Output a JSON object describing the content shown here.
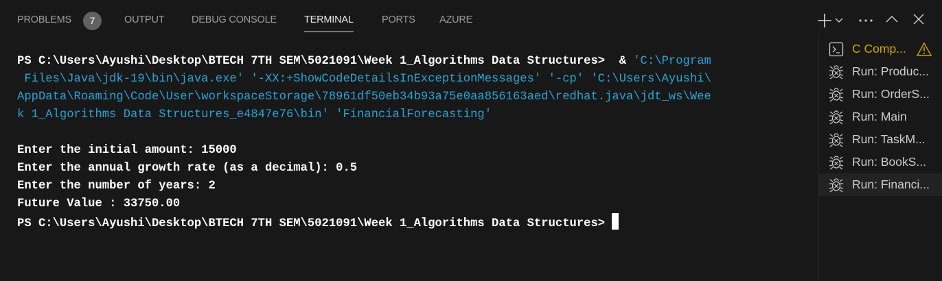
{
  "panel_tabs": [
    {
      "label": "PROBLEMS",
      "badge": "7"
    },
    {
      "label": "OUTPUT"
    },
    {
      "label": "DEBUG CONSOLE"
    },
    {
      "label": "TERMINAL",
      "active": true
    },
    {
      "label": "PORTS"
    },
    {
      "label": "AZURE"
    }
  ],
  "actions": {
    "add": "+",
    "dropdown": "⌄",
    "more": "···",
    "maximize": "^",
    "close": "✕"
  },
  "terminal": {
    "prompt1": "PS C:\\Users\\Ayushi\\Desktop\\BTECH 7TH SEM\\5021091\\Week 1_Algorithms Data Structures>  & ",
    "cmd_l1": "'C:\\Program",
    "cmd_l2": " Files\\Java\\jdk-19\\bin\\java.exe' '-XX:+ShowCodeDetailsInExceptionMessages' '-cp' 'C:\\Users\\Ayushi\\",
    "cmd_l3": "AppData\\Roaming\\Code\\User\\workspaceStorage\\78961df50eb34b93a75e0aa856163aed\\redhat.java\\jdt_ws\\Wee",
    "cmd_l4": "k 1_Algorithms Data Structures_e4847e76\\bin' 'FinancialForecasting'",
    "out1": "Enter the initial amount: 15000",
    "out2": "Enter the annual growth rate (as a decimal): 0.5",
    "out3": "Enter the number of years: 2",
    "out4": "Future Value : 33750.00",
    "prompt2": "PS C:\\Users\\Ayushi\\Desktop\\BTECH 7TH SEM\\5021091\\Week 1_Algorithms Data Structures> "
  },
  "terminal_list": [
    {
      "label": "C Comp...",
      "icon": "terminal-icon",
      "warning": true
    },
    {
      "label": "Run: Produc...",
      "icon": "debug-icon"
    },
    {
      "label": "Run: OrderS...",
      "icon": "debug-icon"
    },
    {
      "label": "Run: Main",
      "icon": "debug-icon"
    },
    {
      "label": "Run: TaskM...",
      "icon": "debug-icon"
    },
    {
      "label": "Run: BookS...",
      "icon": "debug-icon"
    },
    {
      "label": "Run: Financi...",
      "icon": "debug-icon",
      "selected": true
    }
  ],
  "colors": {
    "background": "#181818",
    "cmd": "#29a3d6",
    "warning": "#cca700"
  }
}
